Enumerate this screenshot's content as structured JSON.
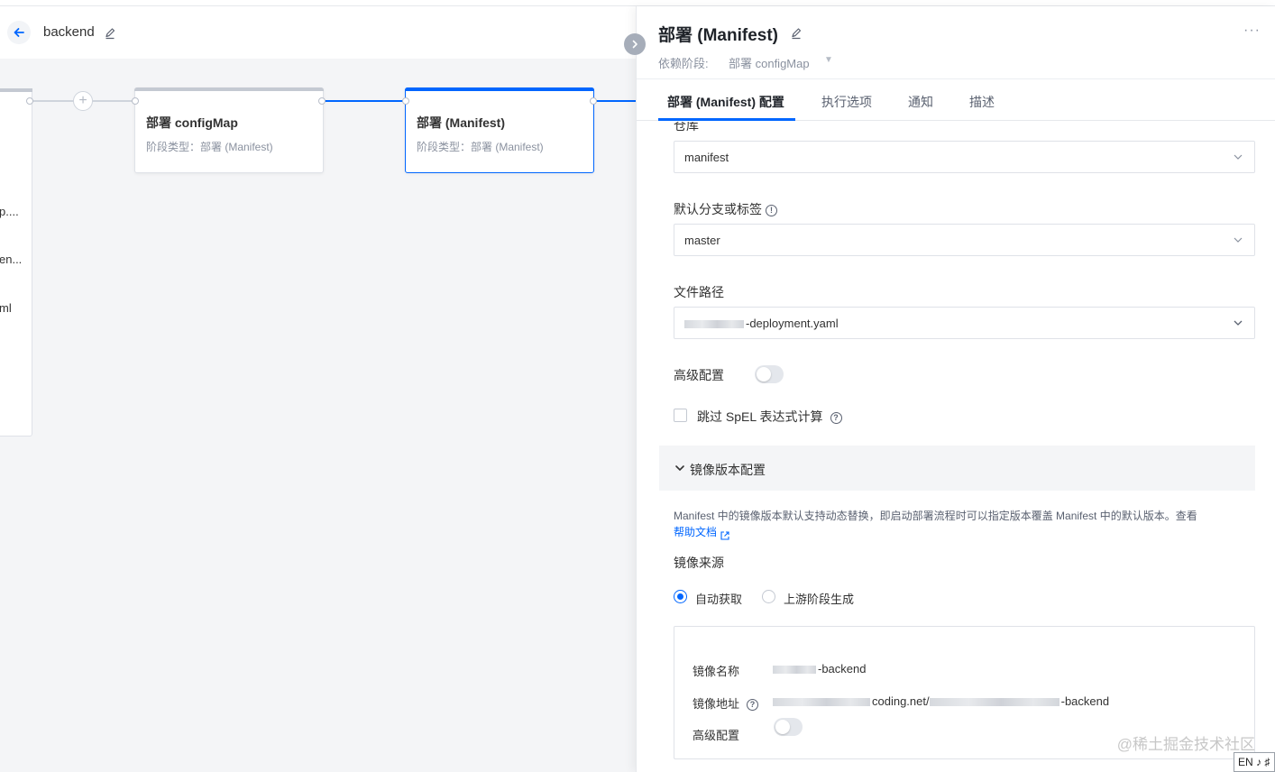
{
  "header": {
    "pipeline_name": "backend"
  },
  "canvas": {
    "prev_card_lines": [
      "p....",
      "en...",
      "ml"
    ],
    "stages": [
      {
        "title": "部署 configMap",
        "type": "阶段类型：部署 (Manifest)"
      },
      {
        "title": "部署 (Manifest)",
        "type": "阶段类型：部署 (Manifest)"
      }
    ]
  },
  "panel": {
    "title": "部署 (Manifest)",
    "more": "···",
    "dependency_label": "依赖阶段:",
    "dependency_value": "部署 configMap",
    "tabs": [
      "部署 (Manifest) 配置",
      "执行选项",
      "通知",
      "描述"
    ],
    "repo_label": "仓库",
    "repo_value": "manifest",
    "branch_label": "默认分支或标签",
    "branch_value": "master",
    "path_label": "文件路径",
    "path_value": "-deployment.yaml",
    "advanced_label": "高级配置",
    "skip_spel_label": "跳过 SpEL 表达式计算",
    "image_section_title": "镜像版本配置",
    "image_desc": "Manifest 中的镜像版本默认支持动态替换，即启动部署流程时可以指定版本覆盖 Manifest 中的默认版本。查看",
    "help_link": "帮助文档",
    "image_source_label": "镜像来源",
    "radio_auto": "自动获取",
    "radio_upstream": "上游阶段生成",
    "image_name_label": "镜像名称",
    "image_name_value": "-backend",
    "image_addr_label": "镜像地址",
    "image_addr_mid": "coding.net/",
    "image_addr_end": "-backend",
    "image_advanced_label": "高级配置"
  },
  "overlay": {
    "watermark": "@稀土掘金技术社区",
    "ime": "EN ♪ ♯"
  },
  "colors": {
    "accent": "#0066ff",
    "canvas_bg": "#f4f5f7"
  }
}
